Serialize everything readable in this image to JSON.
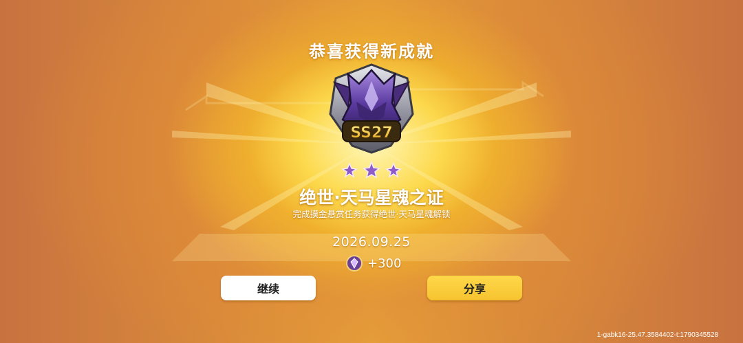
{
  "title": "恭喜获得新成就",
  "badge": {
    "label": "SS27",
    "icon": "pegasus-badge-icon"
  },
  "stars": {
    "count": 3,
    "icon": "star-icon"
  },
  "achievement": {
    "name": "绝世·天马星魂之证",
    "description": "完成摸金悬赏任务获得绝世·天马星魂解锁",
    "date": "2026.09.25"
  },
  "reward": {
    "icon": "gem-icon",
    "amount": "+300"
  },
  "buttons": {
    "continue_label": "继续",
    "share_label": "分享"
  },
  "debug_text": "1-gabk16-25.47.3584402-t:1790345528",
  "colors": {
    "accent": "#f6c32f",
    "background": "#c8763c"
  }
}
